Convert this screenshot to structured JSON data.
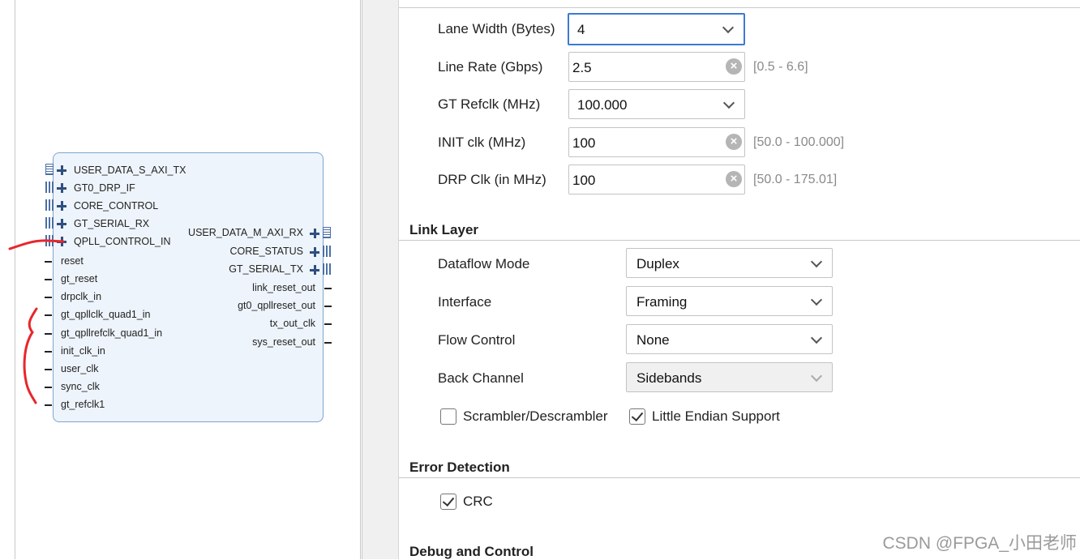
{
  "diagram": {
    "left_ports": [
      {
        "label": "USER_DATA_S_AXI_TX",
        "type": "bus"
      },
      {
        "label": "GT0_DRP_IF",
        "type": "bus"
      },
      {
        "label": "CORE_CONTROL",
        "type": "bus"
      },
      {
        "label": "GT_SERIAL_RX",
        "type": "bus"
      },
      {
        "label": "QPLL_CONTROL_IN",
        "type": "bus"
      },
      {
        "label": "reset",
        "type": "pin"
      },
      {
        "label": "gt_reset",
        "type": "pin"
      },
      {
        "label": "drpclk_in",
        "type": "pin"
      },
      {
        "label": "gt_qpllclk_quad1_in",
        "type": "pin"
      },
      {
        "label": "gt_qpllrefclk_quad1_in",
        "type": "pin"
      },
      {
        "label": "init_clk_in",
        "type": "pin"
      },
      {
        "label": "user_clk",
        "type": "pin"
      },
      {
        "label": "sync_clk",
        "type": "pin"
      },
      {
        "label": "gt_refclk1",
        "type": "pin"
      }
    ],
    "right_ports": [
      {
        "label": "USER_DATA_M_AXI_RX",
        "type": "bus"
      },
      {
        "label": "CORE_STATUS",
        "type": "bus"
      },
      {
        "label": "GT_SERIAL_TX",
        "type": "bus"
      },
      {
        "label": "link_reset_out",
        "type": "pin"
      },
      {
        "label": "gt0_qpllreset_out",
        "type": "pin"
      },
      {
        "label": "tx_out_clk",
        "type": "pin"
      },
      {
        "label": "sys_reset_out",
        "type": "pin"
      }
    ],
    "annotation_color": "#e8262b"
  },
  "physical_layer": {
    "lane_width": {
      "label": "Lane Width (Bytes)",
      "value": "4"
    },
    "line_rate": {
      "label": "Line Rate (Gbps)",
      "value": "2.5",
      "range": "[0.5 - 6.6]"
    },
    "gt_refclk": {
      "label": "GT Refclk (MHz)",
      "value": "100.000"
    },
    "init_clk": {
      "label": "INIT clk (MHz)",
      "value": "100",
      "range": "[50.0 - 100.000]"
    },
    "drp_clk": {
      "label": "DRP Clk (in MHz)",
      "value": "100",
      "range": "[50.0 - 175.01]"
    }
  },
  "link_layer": {
    "title": "Link Layer",
    "dataflow_mode": {
      "label": "Dataflow Mode",
      "value": "Duplex"
    },
    "interface": {
      "label": "Interface",
      "value": "Framing"
    },
    "flow_control": {
      "label": "Flow Control",
      "value": "None"
    },
    "back_channel": {
      "label": "Back Channel",
      "value": "Sidebands"
    },
    "scrambler": {
      "label": "Scrambler/Descrambler",
      "checked": false
    },
    "little_endian": {
      "label": "Little Endian Support",
      "checked": true
    }
  },
  "error_detection": {
    "title": "Error Detection",
    "crc": {
      "label": "CRC",
      "checked": true
    }
  },
  "debug_control": {
    "title": "Debug and Control"
  },
  "watermark": "CSDN @FPGA_小田老师",
  "colors": {
    "focus_border": "#3d7ad4",
    "block_fill": "#eef4fb",
    "block_border": "#7fa4cc",
    "icon_blue": "#2f4f7f"
  }
}
